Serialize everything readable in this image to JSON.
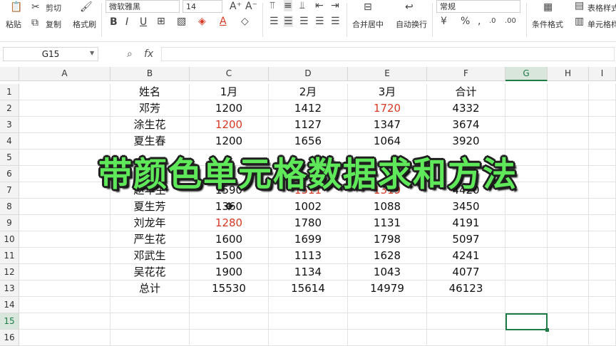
{
  "ribbon": {
    "paste": "粘贴",
    "cut": "剪切",
    "copy": "复制",
    "format_painter": "格式刷",
    "font_name": "微软雅黑",
    "font_size": "14",
    "merge_center": "合并居中",
    "auto_wrap": "自动换行",
    "number_format": "常规",
    "conditional_format": "条件格式",
    "table_style": "表格样式",
    "cell_style": "单元格样"
  },
  "formula_bar": {
    "name_box": "G15",
    "fx": "fx",
    "formula": ""
  },
  "columns": [
    "A",
    "B",
    "C",
    "D",
    "E",
    "F",
    "G",
    "H",
    "I"
  ],
  "selected_column": "G",
  "selected_row": "15",
  "rows": [
    "1",
    "2",
    "3",
    "4",
    "5",
    "6",
    "7",
    "8",
    "9",
    "10",
    "11",
    "12",
    "13",
    "14",
    "15",
    "16"
  ],
  "table": {
    "header": [
      "姓名",
      "1月",
      "2月",
      "3月",
      "合计"
    ],
    "data": [
      [
        "邓芳",
        "1200",
        "1412",
        "1720",
        "4332"
      ],
      [
        "涂生花",
        "1200",
        "1127",
        "1347",
        "3674"
      ],
      [
        "夏生春",
        "1200",
        "1656",
        "1064",
        "3920"
      ],
      [
        "",
        "",
        "",
        "",
        ""
      ],
      [
        "",
        "",
        "",
        "",
        ""
      ],
      [
        "赵年生",
        "1590",
        "1511",
        "1319",
        "4420"
      ],
      [
        "夏生芳",
        "1360",
        "1002",
        "1088",
        "3450"
      ],
      [
        "刘龙年",
        "1280",
        "1780",
        "1131",
        "4191"
      ],
      [
        "严生花",
        "1600",
        "1699",
        "1798",
        "5097"
      ],
      [
        "邓武生",
        "1500",
        "1113",
        "1628",
        "4241"
      ],
      [
        "吴花花",
        "1900",
        "1134",
        "1043",
        "4077"
      ],
      [
        "总计",
        "15530",
        "15614",
        "14979",
        "46123"
      ]
    ],
    "red_cells": [
      "E2",
      "C3",
      "D7",
      "E7",
      "C9"
    ],
    "red_color": "#d63a25"
  },
  "overlay_title": "带颜色单元格数据求和方法",
  "colors": {
    "title_fill": "#5ee85a",
    "title_outline": "#1f1f1f",
    "selection": "#1e7b46"
  }
}
